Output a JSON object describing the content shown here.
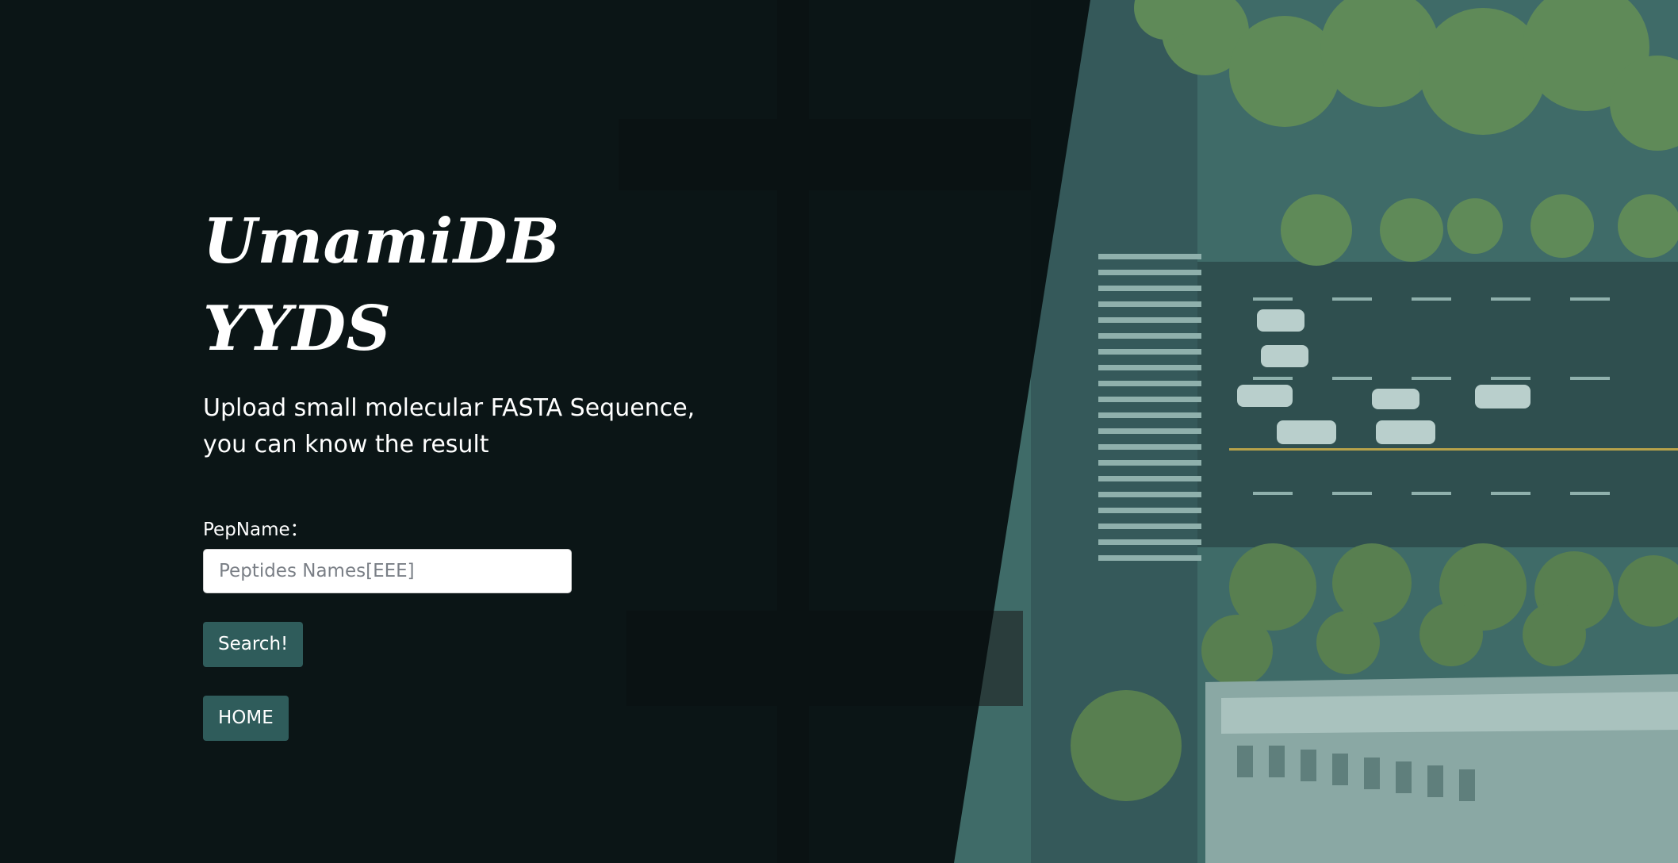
{
  "hero": {
    "title": "UmamiDB YYDS",
    "subtitle": "Upload small molecular FASTA Sequence, you can know the result"
  },
  "form": {
    "pep_name_label": "PepName：",
    "pep_name_placeholder": "Peptides Names[EEE]",
    "pep_name_value": "",
    "search_label": "Search!",
    "home_label": "HOME"
  },
  "colors": {
    "button_bg": "#2f5c5b",
    "overlay_bg": "#080f10",
    "scene_tint": "#3f6b68"
  }
}
